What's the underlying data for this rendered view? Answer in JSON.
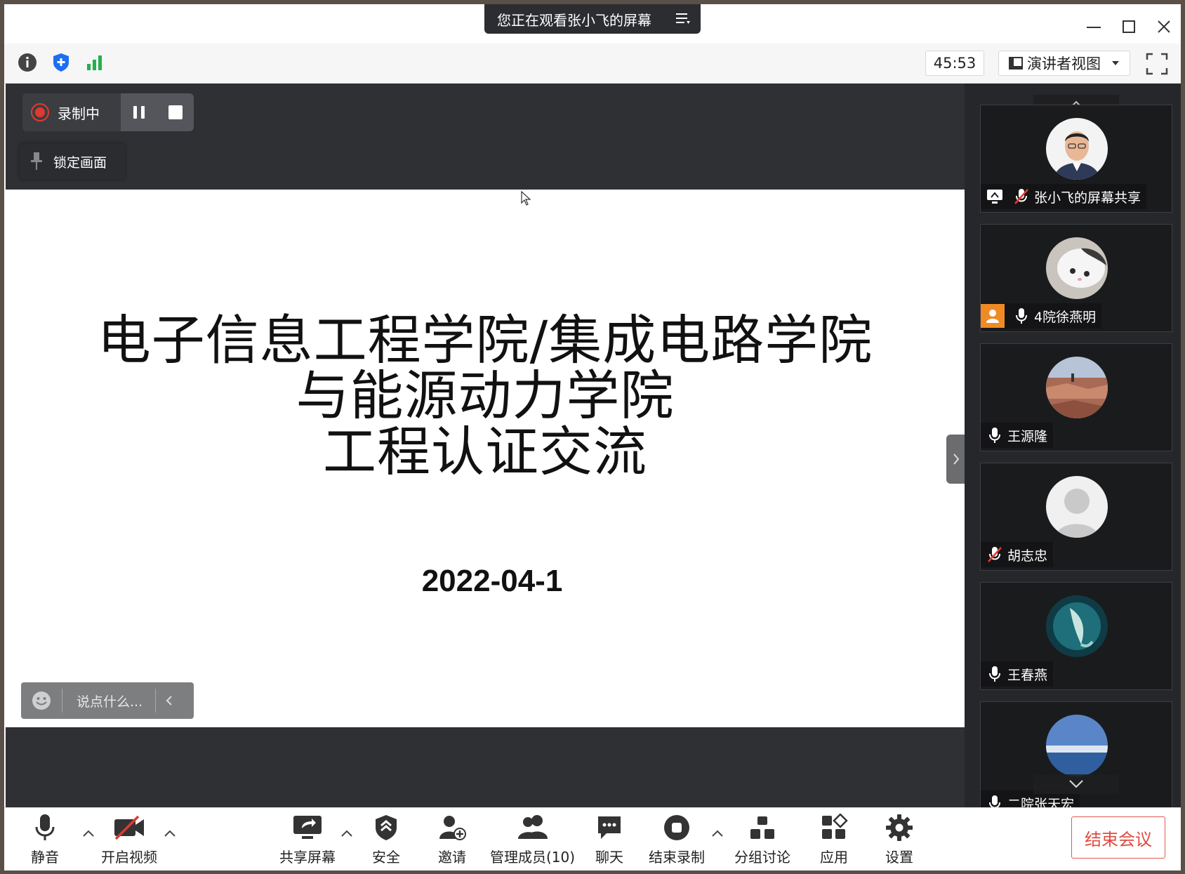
{
  "banner": {
    "text": "您正在观看张小飞的屏幕"
  },
  "toolbar": {
    "timer": "45:53",
    "view_label": "演讲者视图"
  },
  "recording": {
    "label": "录制中"
  },
  "lock": {
    "label": "锁定画面"
  },
  "slide": {
    "line1": "电子信息工程学院/集成电路学院",
    "line2": "与能源动力学院",
    "line3": "工程认证交流",
    "date": "2022-04-1"
  },
  "chat": {
    "placeholder": "说点什么..."
  },
  "participants": [
    {
      "name": "张小飞的屏幕共享"
    },
    {
      "name": "4院徐燕明"
    },
    {
      "name": "王源隆"
    },
    {
      "name": "胡志忠"
    },
    {
      "name": "王春燕"
    },
    {
      "name": "二院张天宏"
    }
  ],
  "bottom": {
    "mute": "静音",
    "video": "开启视频",
    "share": "共享屏幕",
    "security": "安全",
    "invite": "邀请",
    "members": "管理成员(10)",
    "chat": "聊天",
    "end_record": "结束录制",
    "breakout": "分组讨论",
    "apps": "应用",
    "settings": "设置",
    "end_meeting": "结束会议"
  },
  "colors": {
    "accent_red": "#e04a3f",
    "brand_blue": "#1c6ef2",
    "signal_green": "#22b14c",
    "avatar_orange": "#f08a24"
  }
}
